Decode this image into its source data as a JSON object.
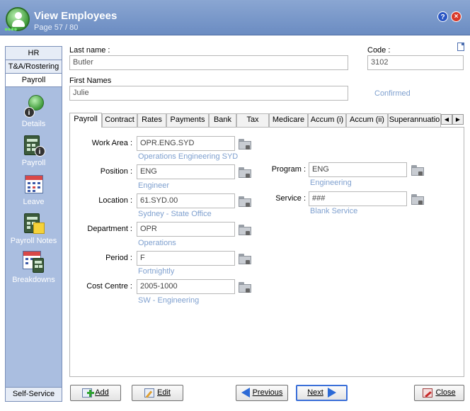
{
  "window": {
    "title": "View Employees",
    "page_info": "Page 57 / 80",
    "help_glyph": "?",
    "close_glyph": "×"
  },
  "sidebar": {
    "tabs": [
      {
        "label": "HR",
        "active": false
      },
      {
        "label": "T&A/Rostering",
        "active": false
      },
      {
        "label": "Payroll",
        "active": true
      }
    ],
    "items": [
      {
        "label": "Details",
        "icon": "employee-info-icon"
      },
      {
        "label": "Payroll",
        "icon": "calculator-info-icon"
      },
      {
        "label": "Leave",
        "icon": "calendar-icon"
      },
      {
        "label": "Payroll Notes",
        "icon": "calculator-note-icon"
      },
      {
        "label": "Breakdowns",
        "icon": "calendar-calculator-icon"
      }
    ],
    "footer": "Self-Service"
  },
  "header": {
    "last_name_label": "Last name :",
    "last_name": "Butler",
    "first_names_label": "First Names",
    "first_names": "Julie",
    "code_label": "Code :",
    "code": "3102",
    "status": "Confirmed"
  },
  "tabs": [
    "Payroll",
    "Contract",
    "Rates",
    "Payments",
    "Bank",
    "Tax",
    "Medicare",
    "Accum (i)",
    "Accum (ii)",
    "Superannuatio"
  ],
  "active_tab": "Payroll",
  "scroll_left": "◀",
  "scroll_right": "▶",
  "payroll": {
    "left_fields": [
      {
        "label": "Work Area :",
        "value": "OPR.ENG.SYD",
        "desc": "Operations Engineering  SYD"
      },
      {
        "label": "Position :",
        "value": "ENG",
        "desc": "Engineer"
      },
      {
        "label": "Location :",
        "value": "61.SYD.00",
        "desc": "Sydney - State Office"
      },
      {
        "label": "Department :",
        "value": "OPR",
        "desc": "Operations"
      },
      {
        "label": "Period :",
        "value": "F",
        "desc": "Fortnightly"
      },
      {
        "label": "Cost Centre :",
        "value": "2005-1000",
        "desc": "SW - Engineering"
      }
    ],
    "right_fields": [
      {
        "label": "Program :",
        "value": "ENG",
        "desc": "Engineering"
      },
      {
        "label": "Service :",
        "value": "###",
        "desc": "Blank Service"
      }
    ]
  },
  "buttons": {
    "add": "Add",
    "edit": "Edit",
    "previous": "Previous",
    "next": "Next",
    "close": "Close"
  }
}
